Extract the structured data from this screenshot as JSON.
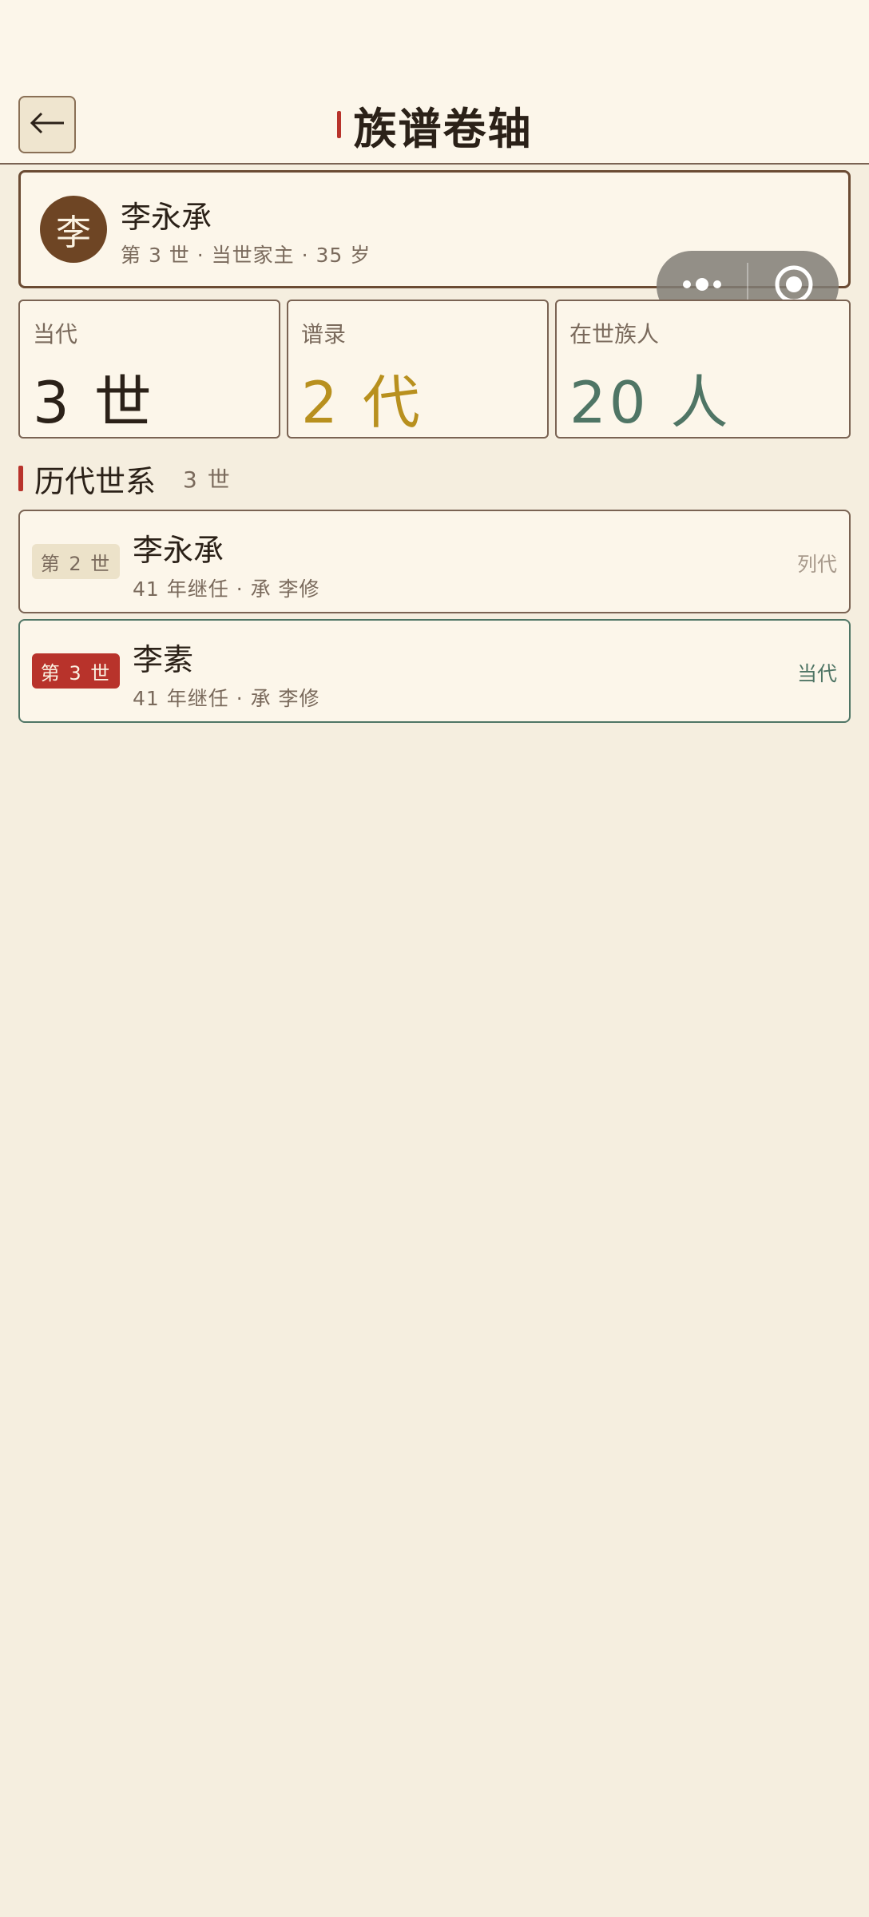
{
  "header": {
    "back_icon": "arrow-left-icon",
    "title": "族谱卷轴",
    "accent_color": "#b8332b"
  },
  "profile": {
    "avatar_char": "李",
    "name": "李永承",
    "subtitle": "第 3 世 · 当世家主 · 35 岁"
  },
  "mini_program_capsule": {
    "more_icon": "more-dots-icon",
    "close_icon": "target-circle-icon"
  },
  "stats": [
    {
      "label": "当代",
      "value": "3 世",
      "color": "#2b2118"
    },
    {
      "label": "谱录",
      "value": "2 代",
      "color": "#b8901e"
    },
    {
      "label": "在世族人",
      "value": "20 人",
      "color": "#4f7565"
    }
  ],
  "section": {
    "title": "历代世系",
    "count": "3 世"
  },
  "generations": [
    {
      "badge": "第 2 世",
      "name": "李永承",
      "detail": "41 年继任 · 承 李修",
      "tag": "列代",
      "current": false
    },
    {
      "badge": "第 3 世",
      "name": "李素",
      "detail": "41 年继任 · 承 李修",
      "tag": "当代",
      "current": true
    }
  ]
}
